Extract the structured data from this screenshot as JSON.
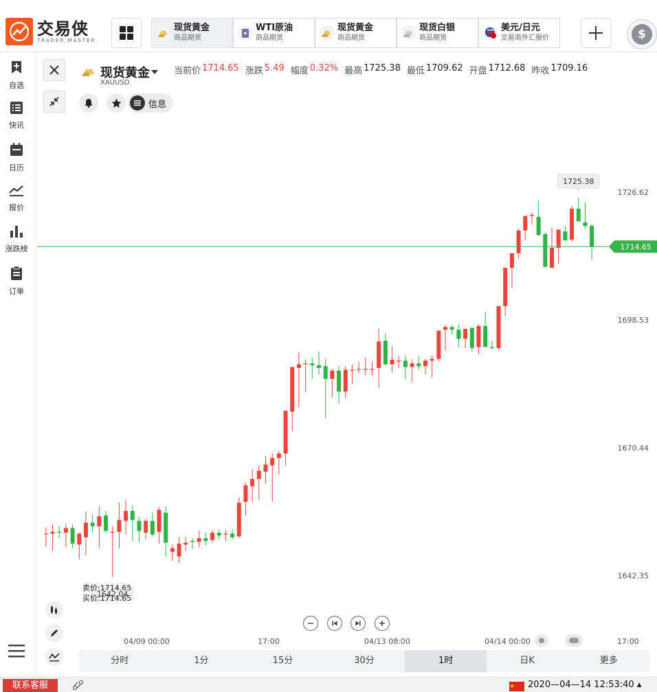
{
  "app": {
    "logo_cn": "交易侠",
    "logo_en": "TRADER MASTER"
  },
  "tabs": [
    {
      "name": "现货黄金",
      "sub": "商品期货",
      "icon": "gold-bar-icon",
      "active": true
    },
    {
      "name": "WTI原油",
      "sub": "商品期货",
      "icon": "oil-drum-icon",
      "active": false
    },
    {
      "name": "现货黄金",
      "sub": "商品期货",
      "icon": "gold-bar-icon",
      "active": false
    },
    {
      "name": "现货白银",
      "sub": "商品期货",
      "icon": "silver-bar-icon",
      "active": false
    },
    {
      "name": "美元/日元",
      "sub": "交易商外汇报价",
      "icon": "us-jp-flag-icon",
      "active": false
    }
  ],
  "sidebar": {
    "items": [
      {
        "label": "自选",
        "icon": "bookmark-plus-icon"
      },
      {
        "label": "快讯",
        "icon": "news-list-icon"
      },
      {
        "label": "日历",
        "icon": "calendar-icon"
      },
      {
        "label": "报价",
        "icon": "line-chart-icon"
      },
      {
        "label": "涨跌榜",
        "icon": "bar-chart-icon"
      },
      {
        "label": "订单",
        "icon": "clipboard-icon"
      }
    ]
  },
  "instrument": {
    "name": "现货黄金",
    "code": "XAUUSD",
    "quote": [
      {
        "label": "当前价",
        "value": "1714.65",
        "up": true
      },
      {
        "label": "涨跌",
        "value": "5.49",
        "up": true
      },
      {
        "label": "幅度",
        "value": "0.32%",
        "up": true
      },
      {
        "label": "最高",
        "value": "1725.38",
        "up": false
      },
      {
        "label": "最低",
        "value": "1709.62",
        "up": false
      },
      {
        "label": "开盘",
        "value": "1712.68",
        "up": false
      },
      {
        "label": "昨收",
        "value": "1709.16",
        "up": false
      }
    ],
    "info_label": "信息"
  },
  "bidask": {
    "sell": "卖价:1714.65",
    "buy": "买价:1714.65"
  },
  "colors": {
    "up": "#e8453c",
    "down": "#2fb344",
    "price_line": "#37b34a",
    "brand": "#ef5a1f"
  },
  "chart_data": {
    "type": "candlestick",
    "y_ticks": [
      "1726.62",
      "1698.53",
      "1670.44",
      "1642.35"
    ],
    "ylim": [
      1634.6,
      1743.2
    ],
    "x_ticks": [
      "04/09 00:00",
      "17:00",
      "04/13 08:00",
      "04/14 00:00",
      "17:00"
    ],
    "high_label": "1725.38",
    "low_label": "1642.04",
    "current_price": "1714.65",
    "candles": [
      [
        1651.6,
        1653.0,
        1648.8,
        1651.6
      ],
      [
        1651.6,
        1653.6,
        1647.8,
        1652.0
      ],
      [
        1652.0,
        1653.2,
        1650.6,
        1651.8
      ],
      [
        1651.8,
        1653.8,
        1648.6,
        1652.8
      ],
      [
        1652.8,
        1653.6,
        1648.4,
        1649.4
      ],
      [
        1649.2,
        1651.8,
        1646.0,
        1651.6
      ],
      [
        1650.8,
        1656.4,
        1646.8,
        1654.0
      ],
      [
        1654.0,
        1655.8,
        1651.8,
        1653.2
      ],
      [
        1653.2,
        1657.6,
        1648.4,
        1655.4
      ],
      [
        1655.6,
        1656.6,
        1651.6,
        1652.2
      ],
      [
        1651.8,
        1653.2,
        1642.0,
        1652.0
      ],
      [
        1652.0,
        1658.4,
        1648.4,
        1654.6
      ],
      [
        1654.4,
        1659.0,
        1651.4,
        1656.6
      ],
      [
        1656.6,
        1657.8,
        1650.0,
        1654.6
      ],
      [
        1654.4,
        1655.2,
        1649.8,
        1652.2
      ],
      [
        1651.8,
        1654.8,
        1650.4,
        1654.4
      ],
      [
        1654.4,
        1656.2,
        1651.0,
        1651.4
      ],
      [
        1652.0,
        1657.4,
        1649.4,
        1656.8
      ],
      [
        1656.2,
        1657.6,
        1646.6,
        1649.6
      ],
      [
        1647.6,
        1649.2,
        1645.6,
        1648.4
      ],
      [
        1646.6,
        1650.8,
        1645.2,
        1649.4
      ],
      [
        1649.2,
        1650.8,
        1647.8,
        1649.6
      ],
      [
        1650.0,
        1650.6,
        1648.2,
        1649.8
      ],
      [
        1649.8,
        1652.2,
        1648.6,
        1650.6
      ],
      [
        1650.6,
        1651.8,
        1649.0,
        1650.0
      ],
      [
        1650.2,
        1652.4,
        1649.6,
        1651.8
      ],
      [
        1651.8,
        1652.4,
        1650.4,
        1651.2
      ],
      [
        1651.4,
        1652.4,
        1650.0,
        1651.6
      ],
      [
        1651.6,
        1652.6,
        1650.2,
        1650.8
      ],
      [
        1651.0,
        1659.6,
        1650.6,
        1658.4
      ],
      [
        1658.6,
        1662.8,
        1655.6,
        1662.2
      ],
      [
        1662.0,
        1665.8,
        1658.6,
        1663.6
      ],
      [
        1663.6,
        1666.6,
        1659.0,
        1665.4
      ],
      [
        1665.2,
        1668.6,
        1662.6,
        1666.8
      ],
      [
        1666.6,
        1669.2,
        1658.6,
        1668.2
      ],
      [
        1668.2,
        1669.8,
        1664.6,
        1669.2
      ],
      [
        1669.2,
        1676.6,
        1666.6,
        1678.6
      ],
      [
        1678.4,
        1686.6,
        1674.2,
        1688.2
      ],
      [
        1688.0,
        1691.4,
        1679.4,
        1688.8
      ],
      [
        1688.8,
        1689.8,
        1682.8,
        1689.0
      ],
      [
        1689.0,
        1690.2,
        1685.6,
        1688.6
      ],
      [
        1688.6,
        1691.6,
        1686.6,
        1688.0
      ],
      [
        1688.4,
        1690.0,
        1677.0,
        1685.6
      ],
      [
        1685.6,
        1687.8,
        1681.6,
        1687.4
      ],
      [
        1687.4,
        1688.4,
        1680.2,
        1682.8
      ],
      [
        1682.8,
        1688.4,
        1681.4,
        1687.6
      ],
      [
        1687.6,
        1688.8,
        1684.4,
        1687.6
      ],
      [
        1687.6,
        1689.4,
        1686.8,
        1687.8
      ],
      [
        1687.8,
        1690.2,
        1686.4,
        1687.8
      ],
      [
        1687.6,
        1689.4,
        1686.4,
        1687.8
      ],
      [
        1688.0,
        1696.6,
        1683.6,
        1693.8
      ],
      [
        1694.0,
        1695.6,
        1688.6,
        1688.8
      ],
      [
        1688.8,
        1692.8,
        1687.0,
        1689.8
      ],
      [
        1689.4,
        1690.6,
        1688.0,
        1689.6
      ],
      [
        1689.6,
        1690.8,
        1685.6,
        1688.2
      ],
      [
        1688.2,
        1690.0,
        1684.8,
        1689.0
      ],
      [
        1689.0,
        1690.6,
        1687.6,
        1688.4
      ],
      [
        1688.4,
        1690.0,
        1686.6,
        1689.6
      ],
      [
        1689.6,
        1690.8,
        1686.0,
        1690.0
      ],
      [
        1690.0,
        1696.2,
        1689.4,
        1696.2
      ],
      [
        1696.4,
        1697.4,
        1691.8,
        1697.0
      ],
      [
        1697.0,
        1697.4,
        1695.4,
        1696.4
      ],
      [
        1696.4,
        1697.6,
        1692.6,
        1694.4
      ],
      [
        1694.4,
        1696.0,
        1692.4,
        1696.6
      ],
      [
        1696.8,
        1696.8,
        1691.6,
        1692.4
      ],
      [
        1692.6,
        1697.6,
        1691.0,
        1697.2
      ],
      [
        1697.2,
        1700.4,
        1696.6,
        1692.6
      ],
      [
        1692.6,
        1694.0,
        1692.0,
        1692.4
      ],
      [
        1692.4,
        1699.6,
        1692.0,
        1701.6
      ],
      [
        1701.6,
        1704.8,
        1699.4,
        1710.0
      ],
      [
        1710.0,
        1713.2,
        1705.6,
        1713.2
      ],
      [
        1713.2,
        1718.6,
        1712.0,
        1718.2
      ],
      [
        1718.2,
        1721.4,
        1716.2,
        1721.4
      ],
      [
        1721.4,
        1722.2,
        1719.6,
        1721.6
      ],
      [
        1721.2,
        1724.8,
        1717.0,
        1717.2
      ],
      [
        1717.4,
        1717.8,
        1713.0,
        1710.2
      ],
      [
        1710.0,
        1718.8,
        1710.0,
        1714.4
      ],
      [
        1714.4,
        1718.0,
        1710.8,
        1718.4
      ],
      [
        1718.0,
        1719.2,
        1716.0,
        1716.0
      ],
      [
        1716.2,
        1723.6,
        1715.8,
        1723.0
      ],
      [
        1723.0,
        1725.4,
        1720.8,
        1720.2
      ],
      [
        1720.0,
        1724.4,
        1718.6,
        1719.2
      ],
      [
        1719.2,
        1719.6,
        1711.8,
        1714.6
      ]
    ]
  },
  "chart_controls": {
    "navigation": [
      "zoom-out-icon",
      "step-back-icon",
      "step-forward-icon",
      "zoom-in-icon"
    ]
  },
  "periods": [
    "分时",
    "1分",
    "15分",
    "30分",
    "1时",
    "日K",
    "更多"
  ],
  "active_period": "1时",
  "status": {
    "contact": "联系客服",
    "time": "2020—04—14 12:53:40 ▴"
  }
}
